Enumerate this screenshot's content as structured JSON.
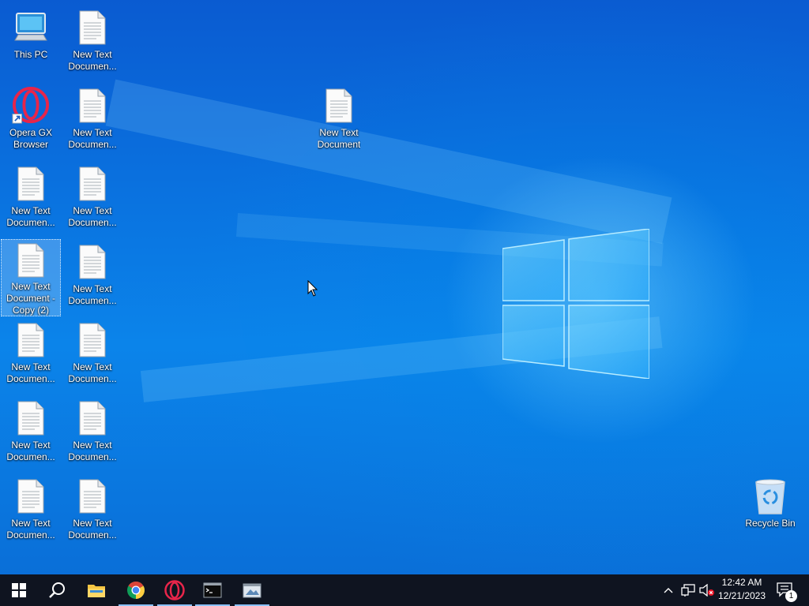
{
  "desktop": {
    "icons": [
      {
        "label": "This PC",
        "icon": "this-pc-icon"
      },
      {
        "label": "New Text\nDocumen...",
        "icon": "text-document-icon"
      },
      {
        "label": "Opera GX\nBrowser",
        "icon": "opera-gx-icon"
      },
      {
        "label": "New Text\nDocumen...",
        "icon": "text-document-icon"
      },
      {
        "label": "New Text\nDocumen...",
        "icon": "text-document-icon"
      },
      {
        "label": "New Text\nDocumen...",
        "icon": "text-document-icon"
      },
      {
        "label": "New Text\nDocument -\nCopy (2)",
        "icon": "text-document-icon"
      },
      {
        "label": "New Text\nDocumen...",
        "icon": "text-document-icon"
      },
      {
        "label": "New Text\nDocumen...",
        "icon": "text-document-icon"
      },
      {
        "label": "New Text\nDocumen...",
        "icon": "text-document-icon"
      },
      {
        "label": "New Text\nDocumen...",
        "icon": "text-document-icon"
      },
      {
        "label": "New Text\nDocumen...",
        "icon": "text-document-icon"
      },
      {
        "label": "New Text\nDocumen...",
        "icon": "text-document-icon"
      },
      {
        "label": "New Text\nDocumen...",
        "icon": "text-document-icon"
      },
      {
        "label": "New Text\nDocument",
        "icon": "text-document-icon"
      },
      {
        "label": "Recycle Bin",
        "icon": "recycle-bin-icon"
      }
    ]
  },
  "taskbar": {
    "buttons": [
      {
        "name": "start",
        "icon": "windows-start-icon"
      },
      {
        "name": "search",
        "icon": "search-icon"
      },
      {
        "name": "file-explorer",
        "icon": "folder-icon"
      },
      {
        "name": "chrome",
        "icon": "chrome-icon"
      },
      {
        "name": "opera",
        "icon": "opera-icon"
      },
      {
        "name": "terminal",
        "icon": "terminal-icon"
      },
      {
        "name": "app",
        "icon": "app-window-icon"
      }
    ],
    "tray": {
      "time": "12:42 AM",
      "date": "12/21/2023",
      "notification_count": "1"
    }
  },
  "colors": {
    "taskbar_bg": "#0f1420",
    "accent": "#8ac2ff"
  }
}
